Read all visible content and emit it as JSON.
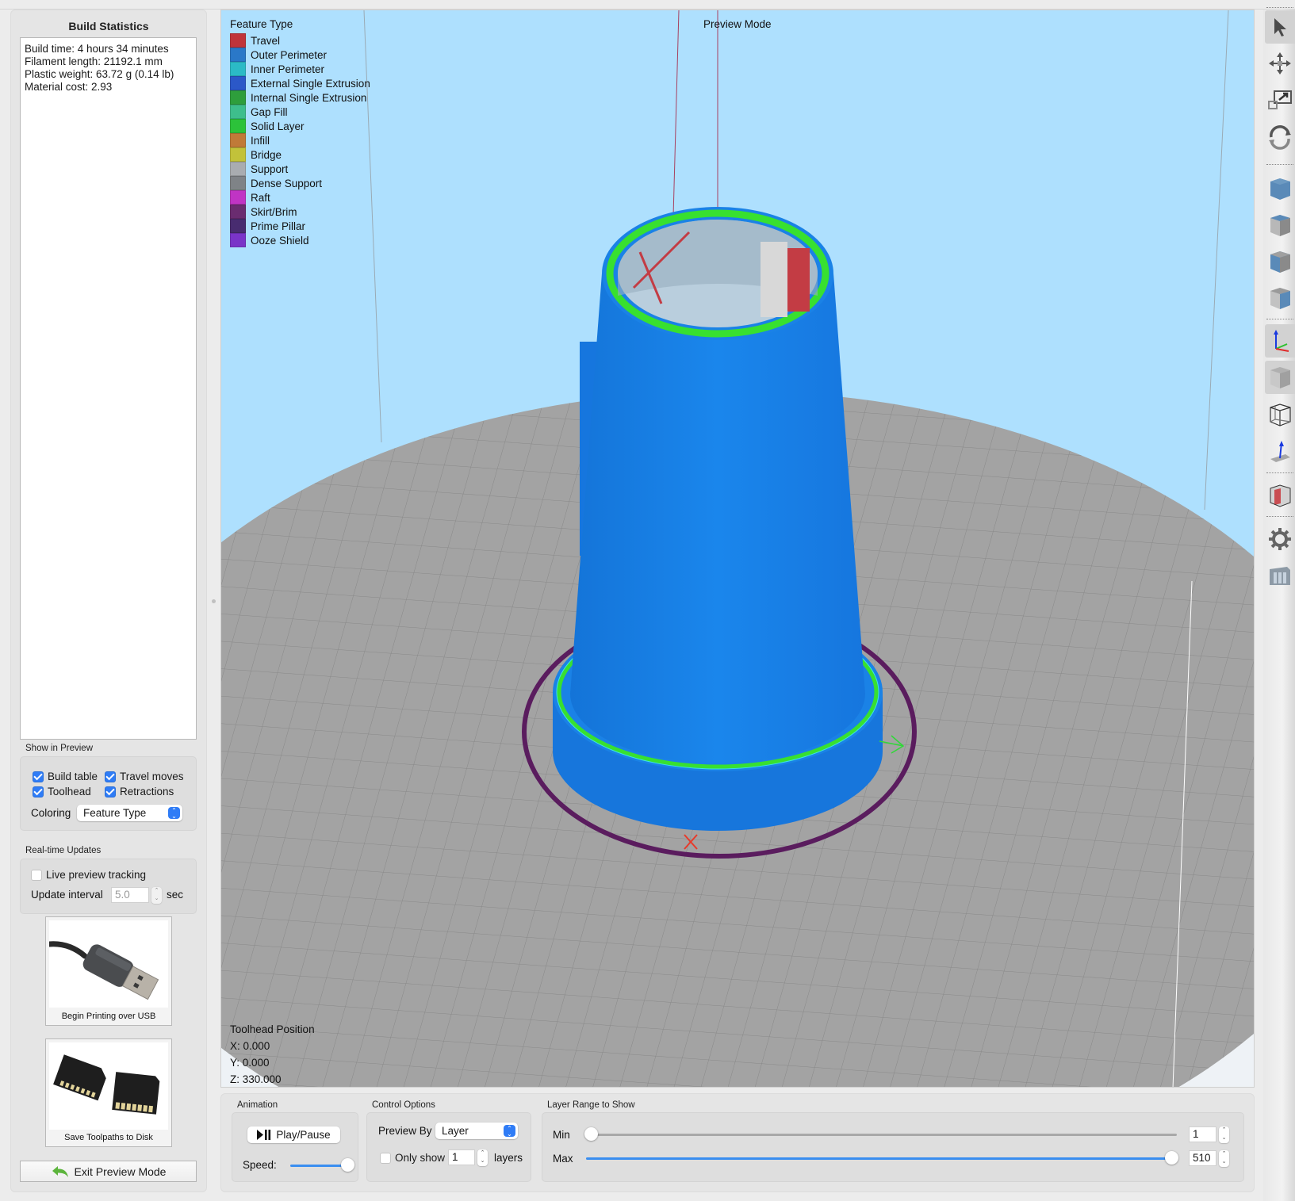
{
  "build_statistics": {
    "title": "Build Statistics",
    "lines": [
      "Build time: 4 hours 34 minutes",
      "Filament length: 21192.1 mm",
      "Plastic weight: 63.72 g (0.14 lb)",
      "Material cost: 2.93"
    ]
  },
  "show_in_preview": {
    "label": "Show in Preview",
    "build_table": {
      "label": "Build table",
      "checked": true
    },
    "travel_moves": {
      "label": "Travel moves",
      "checked": true
    },
    "toolhead": {
      "label": "Toolhead",
      "checked": true
    },
    "retractions": {
      "label": "Retractions",
      "checked": true
    },
    "coloring_label": "Coloring",
    "coloring_value": "Feature Type"
  },
  "realtime_updates": {
    "label": "Real-time Updates",
    "live_tracking": {
      "label": "Live preview tracking",
      "checked": false
    },
    "interval_label": "Update interval",
    "interval_value": "5.0",
    "interval_unit": "sec"
  },
  "actions": {
    "usb_label": "Begin Printing over USB",
    "disk_label": "Save Toolpaths to Disk",
    "exit_label": "Exit Preview Mode"
  },
  "viewport": {
    "mode_label": "Preview Mode",
    "legend_title": "Feature Type",
    "legend": [
      {
        "label": "Travel",
        "color": "#c0343a"
      },
      {
        "label": "Outer Perimeter",
        "color": "#2a78c8"
      },
      {
        "label": "Inner Perimeter",
        "color": "#2bbac6"
      },
      {
        "label": "External Single Extrusion",
        "color": "#2b58c8"
      },
      {
        "label": "Internal Single Extrusion",
        "color": "#2e9e3c"
      },
      {
        "label": "Gap Fill",
        "color": "#3ebe8c"
      },
      {
        "label": "Solid Layer",
        "color": "#2cc23a"
      },
      {
        "label": "Infill",
        "color": "#c07a38"
      },
      {
        "label": "Bridge",
        "color": "#c2c23a"
      },
      {
        "label": "Support",
        "color": "#a9acb0"
      },
      {
        "label": "Dense Support",
        "color": "#7f8387"
      },
      {
        "label": "Raft",
        "color": "#c034c4"
      },
      {
        "label": "Skirt/Brim",
        "color": "#6a2c70"
      },
      {
        "label": "Prime Pillar",
        "color": "#482c70"
      },
      {
        "label": "Ooze Shield",
        "color": "#7a34c8"
      }
    ],
    "toolhead_title": "Toolhead Position",
    "toolhead_x": "X: 0.000",
    "toolhead_y": "Y: 0.000",
    "toolhead_z": "Z: 330.000",
    "colors": {
      "background": "#aee0fe",
      "bed": "#a3a3a3",
      "part": "#1a82e6",
      "solid_ring": "#38e030",
      "skirt": "#5a1c5e"
    }
  },
  "toolbar": {
    "tools": [
      {
        "name": "select-tool-icon",
        "active": true
      },
      {
        "name": "move-tool-icon",
        "active": false
      },
      {
        "name": "scale-tool-icon",
        "active": false
      },
      {
        "name": "rotate-tool-icon",
        "active": false
      },
      {
        "name": "view-front-icon",
        "active": false
      },
      {
        "name": "view-top-icon",
        "active": false
      },
      {
        "name": "view-side-icon",
        "active": false
      },
      {
        "name": "view-iso-icon",
        "active": false
      },
      {
        "name": "axes-icon",
        "active": true
      },
      {
        "name": "solid-view-icon",
        "active": true
      },
      {
        "name": "wireframe-view-icon",
        "active": false
      },
      {
        "name": "normals-icon",
        "active": false
      },
      {
        "name": "section-view-icon",
        "active": false
      },
      {
        "name": "settings-gear-icon",
        "active": false
      },
      {
        "name": "machine-icon",
        "active": false
      }
    ]
  },
  "animation": {
    "label": "Animation",
    "play_label": "Play/Pause",
    "speed_label": "Speed:",
    "speed_fraction": 1.0
  },
  "control_options": {
    "label": "Control Options",
    "preview_by_label": "Preview By",
    "preview_by_value": "Layer",
    "only_show_label": "Only show",
    "only_show_checked": false,
    "only_show_value": "1",
    "only_show_unit": "layers"
  },
  "layer_range": {
    "label": "Layer Range to Show",
    "min_label": "Min",
    "max_label": "Max",
    "min_value": "1",
    "max_value": "510",
    "layer_count": 510
  }
}
